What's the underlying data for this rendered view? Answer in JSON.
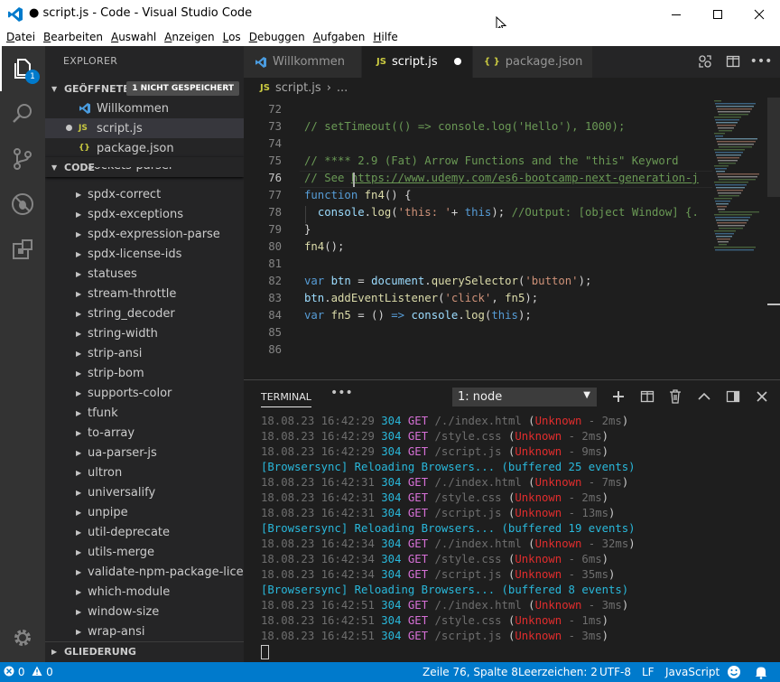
{
  "window": {
    "title": "● script.js - Code - Visual Studio Code"
  },
  "menu": {
    "items": [
      {
        "u": "D",
        "rest": "atei"
      },
      {
        "u": "B",
        "rest": "earbeiten"
      },
      {
        "u": "A",
        "rest": "uswahl"
      },
      {
        "u": "A",
        "rest": "nzeigen"
      },
      {
        "u": "L",
        "rest": "os"
      },
      {
        "u": "D",
        "rest": "ebuggen"
      },
      {
        "u": "A",
        "rest": "ufgaben"
      },
      {
        "u": "H",
        "rest": "ilfe"
      }
    ]
  },
  "activity": {
    "explorer_badge": "1"
  },
  "sidebar": {
    "title": "EXPLORER",
    "open_editors": {
      "label": "GEÖFFNETE E...",
      "unsaved": "1 NICHT GESPEICHERT",
      "items": [
        {
          "icon": "vscode-icon",
          "label": "Willkommen"
        },
        {
          "icon": "js-icon",
          "icon_text": "JS",
          "label": "script.js"
        },
        {
          "icon": "json-icon",
          "icon_text": "{}",
          "label": "package.json"
        }
      ]
    },
    "code_section": {
      "label": "CODE",
      "partial_item": "sockets-parser",
      "items": [
        "spdx-correct",
        "spdx-exceptions",
        "spdx-expression-parse",
        "spdx-license-ids",
        "statuses",
        "stream-throttle",
        "string_decoder",
        "string-width",
        "strip-ansi",
        "strip-bom",
        "supports-color",
        "tfunk",
        "to-array",
        "ua-parser-js",
        "ultron",
        "universalify",
        "unpipe",
        "util-deprecate",
        "utils-merge",
        "validate-npm-package-licen...",
        "which-module",
        "window-size",
        "wrap-ansi"
      ]
    },
    "outline_label": "GLIEDERUNG"
  },
  "tabs": [
    {
      "label": "Willkommen",
      "icon": "vscode-icon"
    },
    {
      "label": "script.js",
      "icon_text": "JS",
      "active": true,
      "dirty": true
    },
    {
      "label": "package.json",
      "icon_text": "{ }"
    }
  ],
  "breadcrumb": {
    "icon_text": "JS",
    "file": "script.js",
    "sep": "› ...",
    "ellipsis": "..."
  },
  "editor": {
    "current_line": "76",
    "lines": [
      {
        "n": "72",
        "tokens": []
      },
      {
        "n": "73",
        "tokens": [
          {
            "c": "c-com",
            "t": "// setTimeout(() => console.log('Hello'), 1000);"
          }
        ]
      },
      {
        "n": "74",
        "tokens": []
      },
      {
        "n": "75",
        "tokens": [
          {
            "c": "c-com",
            "t": "// **** 2.9 (Fat) Arrow Functions and the \"this\" Keyword"
          }
        ]
      },
      {
        "n": "76",
        "tokens": [
          {
            "c": "c-com",
            "t": "// See "
          },
          {
            "c": "c-link",
            "t": "https://www.udemy.com/es6-bootcamp-next-generation-j"
          }
        ]
      },
      {
        "n": "77",
        "tokens": [
          {
            "c": "c-kw",
            "t": "function "
          },
          {
            "c": "c-fn",
            "t": "fn4"
          },
          {
            "c": "c-plain",
            "t": "() {"
          }
        ]
      },
      {
        "n": "78",
        "tokens": [
          {
            "c": "c-plain",
            "t": "  "
          },
          {
            "c": "c-var",
            "t": "console"
          },
          {
            "c": "c-plain",
            "t": "."
          },
          {
            "c": "c-fn",
            "t": "log"
          },
          {
            "c": "c-plain",
            "t": "("
          },
          {
            "c": "c-str",
            "t": "'this: '"
          },
          {
            "c": "c-plain",
            "t": "+ "
          },
          {
            "c": "c-kw",
            "t": "this"
          },
          {
            "c": "c-plain",
            "t": "); "
          },
          {
            "c": "c-com",
            "t": "//Output: [object Window] {."
          }
        ]
      },
      {
        "n": "79",
        "tokens": [
          {
            "c": "c-plain",
            "t": "}"
          }
        ]
      },
      {
        "n": "80",
        "tokens": [
          {
            "c": "c-fn",
            "t": "fn4"
          },
          {
            "c": "c-plain",
            "t": "();"
          }
        ]
      },
      {
        "n": "81",
        "tokens": []
      },
      {
        "n": "82",
        "tokens": [
          {
            "c": "c-kw",
            "t": "var "
          },
          {
            "c": "c-var",
            "t": "btn"
          },
          {
            "c": "c-plain",
            "t": " = "
          },
          {
            "c": "c-var",
            "t": "document"
          },
          {
            "c": "c-plain",
            "t": "."
          },
          {
            "c": "c-fn",
            "t": "querySelector"
          },
          {
            "c": "c-plain",
            "t": "("
          },
          {
            "c": "c-str",
            "t": "'button'"
          },
          {
            "c": "c-plain",
            "t": ");"
          }
        ]
      },
      {
        "n": "83",
        "tokens": [
          {
            "c": "c-var",
            "t": "btn"
          },
          {
            "c": "c-plain",
            "t": "."
          },
          {
            "c": "c-fn",
            "t": "addEventListener"
          },
          {
            "c": "c-plain",
            "t": "("
          },
          {
            "c": "c-str",
            "t": "'click'"
          },
          {
            "c": "c-plain",
            "t": ", "
          },
          {
            "c": "c-fn",
            "t": "fn5"
          },
          {
            "c": "c-plain",
            "t": ");"
          }
        ]
      },
      {
        "n": "84",
        "tokens": [
          {
            "c": "c-kw",
            "t": "var "
          },
          {
            "c": "c-fn",
            "t": "fn5"
          },
          {
            "c": "c-plain",
            "t": " = () "
          },
          {
            "c": "c-kw",
            "t": "=>"
          },
          {
            "c": "c-plain",
            "t": " "
          },
          {
            "c": "c-var",
            "t": "console"
          },
          {
            "c": "c-plain",
            "t": "."
          },
          {
            "c": "c-fn",
            "t": "log"
          },
          {
            "c": "c-plain",
            "t": "("
          },
          {
            "c": "c-kw",
            "t": "this"
          },
          {
            "c": "c-plain",
            "t": ");"
          }
        ]
      },
      {
        "n": "85",
        "tokens": []
      },
      {
        "n": "86",
        "tokens": []
      }
    ]
  },
  "terminal": {
    "tab_label": "TERMINAL",
    "more": "•••",
    "selected_shell": "1: node",
    "lines": [
      {
        "kind": "req",
        "time": "18.08.23 16:42:29",
        "code": "304",
        "method": "GET",
        "path": "/./index.html",
        "unk": "Unknown",
        "ms": " - 2ms"
      },
      {
        "kind": "req",
        "time": "18.08.23 16:42:29",
        "code": "304",
        "method": "GET",
        "path": "/style.css",
        "unk": "Unknown",
        "ms": " - 2ms"
      },
      {
        "kind": "req",
        "time": "18.08.23 16:42:29",
        "code": "304",
        "method": "GET",
        "path": "/script.js",
        "unk": "Unknown",
        "ms": " - 9ms"
      },
      {
        "kind": "bs",
        "text": "[Browsersync] Reloading Browsers... (buffered 25 events)"
      },
      {
        "kind": "req",
        "time": "18.08.23 16:42:31",
        "code": "304",
        "method": "GET",
        "path": "/./index.html",
        "unk": "Unknown",
        "ms": " - 7ms"
      },
      {
        "kind": "req",
        "time": "18.08.23 16:42:31",
        "code": "304",
        "method": "GET",
        "path": "/style.css",
        "unk": "Unknown",
        "ms": " - 2ms"
      },
      {
        "kind": "req",
        "time": "18.08.23 16:42:31",
        "code": "304",
        "method": "GET",
        "path": "/script.js",
        "unk": "Unknown",
        "ms": " - 13ms"
      },
      {
        "kind": "bs",
        "text": "[Browsersync] Reloading Browsers... (buffered 19 events)"
      },
      {
        "kind": "req",
        "time": "18.08.23 16:42:34",
        "code": "304",
        "method": "GET",
        "path": "/./index.html",
        "unk": "Unknown",
        "ms": " - 32ms"
      },
      {
        "kind": "req",
        "time": "18.08.23 16:42:34",
        "code": "304",
        "method": "GET",
        "path": "/style.css",
        "unk": "Unknown",
        "ms": " - 6ms"
      },
      {
        "kind": "req",
        "time": "18.08.23 16:42:34",
        "code": "304",
        "method": "GET",
        "path": "/script.js",
        "unk": "Unknown",
        "ms": " - 35ms"
      },
      {
        "kind": "bs",
        "text": "[Browsersync] Reloading Browsers... (buffered 8 events)"
      },
      {
        "kind": "req",
        "time": "18.08.23 16:42:51",
        "code": "304",
        "method": "GET",
        "path": "/./index.html",
        "unk": "Unknown",
        "ms": " - 3ms"
      },
      {
        "kind": "req",
        "time": "18.08.23 16:42:51",
        "code": "304",
        "method": "GET",
        "path": "/style.css",
        "unk": "Unknown",
        "ms": " - 1ms"
      },
      {
        "kind": "req",
        "time": "18.08.23 16:42:51",
        "code": "304",
        "method": "GET",
        "path": "/script.js",
        "unk": "Unknown",
        "ms": " - 3ms"
      }
    ]
  },
  "status": {
    "errors": "0",
    "warnings": "0",
    "position": "Zeile 76, Spalte 8",
    "spaces": "Leerzeichen: 2",
    "encoding": "UTF-8",
    "eol": "LF",
    "language": "JavaScript"
  },
  "colors": {
    "accent": "#007acc",
    "activity_bg": "#333333",
    "sidebar_bg": "#252526",
    "editor_bg": "#1e1e1e"
  }
}
